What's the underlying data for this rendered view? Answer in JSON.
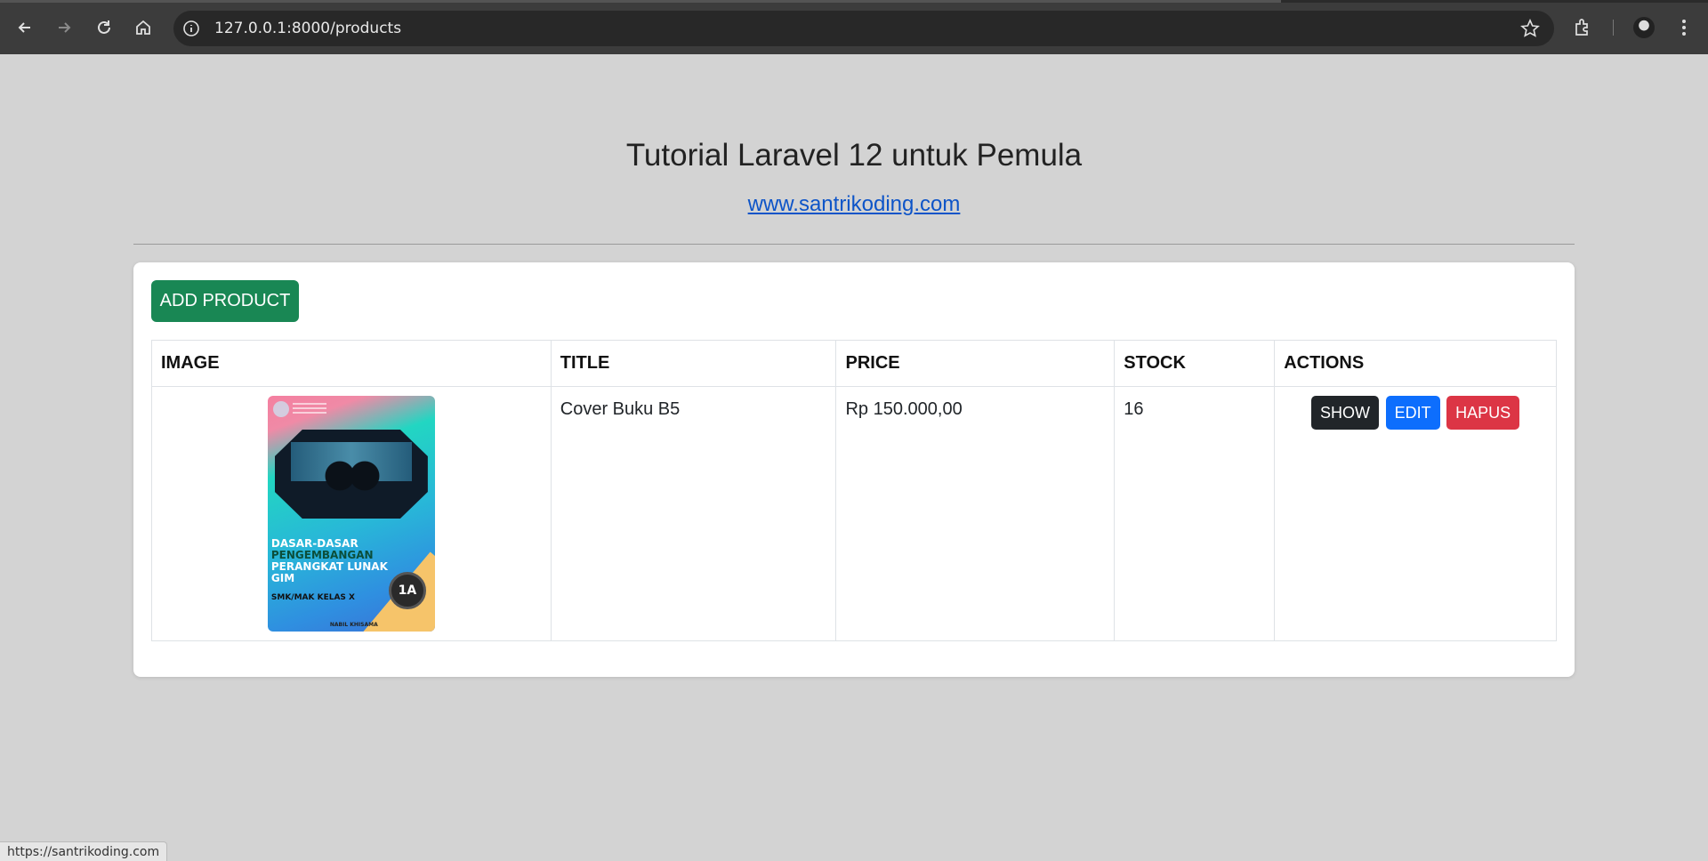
{
  "browser": {
    "url": "127.0.0.1:8000/products",
    "status_url": "https://santrikoding.com"
  },
  "page": {
    "title": "Tutorial Laravel 12 untuk Pemula",
    "link_text": "www.santrikoding.com",
    "add_button_label": "ADD PRODUCT"
  },
  "table": {
    "headers": {
      "image": "IMAGE",
      "title": "TITLE",
      "price": "PRICE",
      "stock": "STOCK",
      "actions": "ACTIONS"
    },
    "rows": [
      {
        "cover": {
          "line1": "DASAR-DASAR",
          "line2": "PENGEMBANGAN",
          "line3": "PERANGKAT LUNAK",
          "line4": "GIM",
          "subtitle": "SMK/MAK KELAS X",
          "badge": "1A",
          "author": "NABIL KHISAMA"
        },
        "title": "Cover Buku B5",
        "price": "Rp 150.000,00",
        "stock": "16",
        "actions": {
          "show": "SHOW",
          "edit": "EDIT",
          "delete": "HAPUS"
        }
      }
    ]
  },
  "colors": {
    "page_bg": "#d3d3d3",
    "add_button": "#198754",
    "show_button": "#212529",
    "edit_button": "#0d6efd",
    "delete_button": "#dc3545",
    "link": "#0d54c8"
  }
}
